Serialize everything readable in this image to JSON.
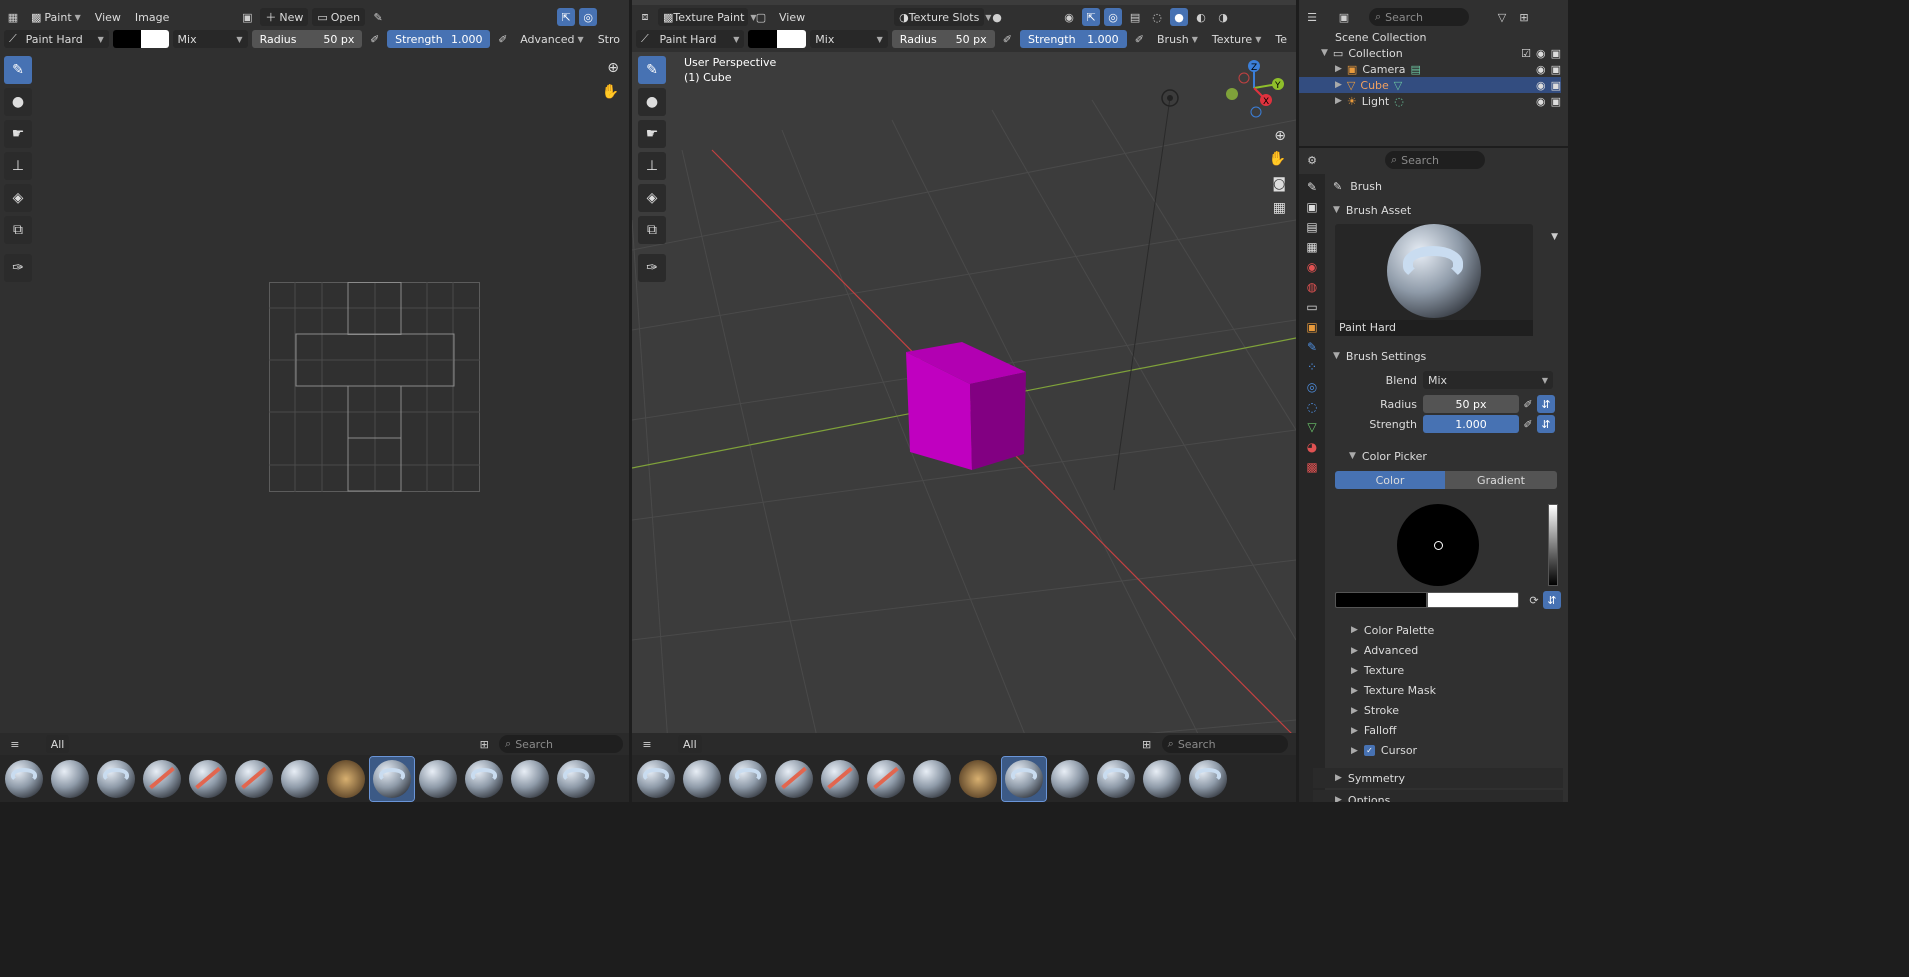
{
  "colors": {
    "accent": "#4772b3",
    "cube": "#c000c0",
    "x_axis": "#c24141",
    "y_axis": "#7fa23a"
  },
  "image_editor": {
    "menus": [
      "Paint",
      "View",
      "Image"
    ],
    "new_label": "New",
    "open_label": "Open",
    "brush": "Paint Hard",
    "blend": "Mix",
    "radius_label": "Radius",
    "radius_value": "50 px",
    "strength_label": "Strength",
    "strength_value": "1.000",
    "advanced_label": "Advanced",
    "stroke_label": "Stro"
  },
  "viewport": {
    "mode": "Texture Paint",
    "view_menu": "View",
    "slots": "Texture Slots",
    "brush": "Paint Hard",
    "blend": "Mix",
    "radius_label": "Radius",
    "radius_value": "50 px",
    "strength_label": "Strength",
    "strength_value": "1.000",
    "brush_menu": "Brush",
    "texture_menu": "Texture",
    "cut_label": "Te",
    "overlay_title": "User Perspective",
    "overlay_object": "(1) Cube",
    "gizmo": {
      "z": "Z",
      "y": "Y",
      "x": "X"
    }
  },
  "asset_shelf": {
    "tab": "All",
    "search_placeholder": "Search"
  },
  "outliner": {
    "search_placeholder": "Search",
    "scene_collection": "Scene Collection",
    "collection": "Collection",
    "items": [
      "Camera",
      "Cube",
      "Light"
    ]
  },
  "properties": {
    "search_placeholder": "Search",
    "title": "Brush",
    "brush_asset_header": "Brush Asset",
    "brush_asset_name": "Paint Hard",
    "brush_settings_header": "Brush Settings",
    "blend_label": "Blend",
    "blend_value": "Mix",
    "radius_label": "Radius",
    "radius_value": "50 px",
    "strength_label": "Strength",
    "strength_value": "1.000",
    "color_picker_header": "Color Picker",
    "color_tab": "Color",
    "gradient_tab": "Gradient",
    "subpanels": [
      "Color Palette",
      "Advanced",
      "Texture",
      "Texture Mask",
      "Stroke",
      "Falloff",
      "Cursor"
    ],
    "symmetry": "Symmetry",
    "options": "Options"
  }
}
